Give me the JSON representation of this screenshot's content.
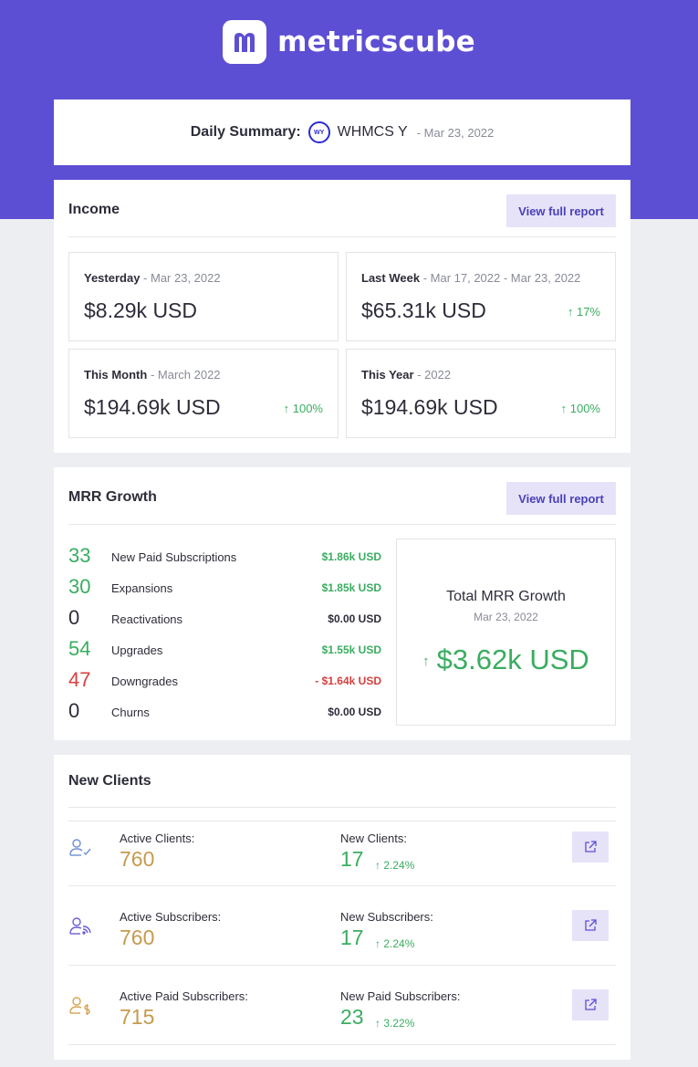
{
  "brand": {
    "name": "metricscube",
    "logo_letter": "m"
  },
  "colors": {
    "brand": "#5d4fd3",
    "positive": "#3aad60",
    "negative": "#d6403e",
    "clients_value": "#c69a4e",
    "button_bg": "#e6e3f8"
  },
  "summary": {
    "label": "Daily Summary:",
    "badge": "WY",
    "company": "WHMCS Y",
    "date": "- Mar 23, 2022"
  },
  "income": {
    "title": "Income",
    "button": "View full report",
    "boxes": [
      {
        "label": "Yesterday",
        "period": " - Mar 23, 2022",
        "value": "$8.29k USD",
        "change": ""
      },
      {
        "label": "Last Week",
        "period": " - Mar 17, 2022 - Mar 23, 2022",
        "value": "$65.31k USD",
        "change": "↑  17%"
      },
      {
        "label": "This Month",
        "period": " - March 2022",
        "value": "$194.69k USD",
        "change": "↑  100%"
      },
      {
        "label": "This Year",
        "period": " - 2022",
        "value": "$194.69k USD",
        "change": "↑  100%"
      }
    ]
  },
  "mrr": {
    "title": "MRR Growth",
    "button": "View full report",
    "rows": [
      {
        "count": "33",
        "name": "New Paid Subscriptions",
        "amount": "$1.86k USD",
        "tone": "green"
      },
      {
        "count": "30",
        "name": "Expansions",
        "amount": "$1.85k USD",
        "tone": "green"
      },
      {
        "count": "0",
        "name": "Reactivations",
        "amount": "$0.00 USD",
        "tone": "dark"
      },
      {
        "count": "54",
        "name": "Upgrades",
        "amount": "$1.55k USD",
        "tone": "green"
      },
      {
        "count": "47",
        "name": "Downgrades",
        "amount": "- $1.64k USD",
        "tone": "red"
      },
      {
        "count": "0",
        "name": "Churns",
        "amount": "$0.00 USD",
        "tone": "dark"
      }
    ],
    "total": {
      "title": "Total MRR Growth",
      "date": "Mar 23, 2022",
      "arrow": "↑",
      "value": "$3.62k USD"
    }
  },
  "clients": {
    "title": "New Clients",
    "rows": [
      {
        "icon": "user-check-icon",
        "label1": "Active Clients:",
        "value1": "760",
        "label2": "New Clients:",
        "value2": "17",
        "change": "↑  2.24%"
      },
      {
        "icon": "user-subscribe-icon",
        "label1": "Active Subscribers:",
        "value1": "760",
        "label2": "New Subscribers:",
        "value2": "17",
        "change": "↑  2.24%"
      },
      {
        "icon": "user-dollar-icon",
        "label1": "Active Paid Subscribers:",
        "value1": "715",
        "label2": "New Paid Subscribers:",
        "value2": "23",
        "change": "↑  3.22%"
      }
    ]
  }
}
